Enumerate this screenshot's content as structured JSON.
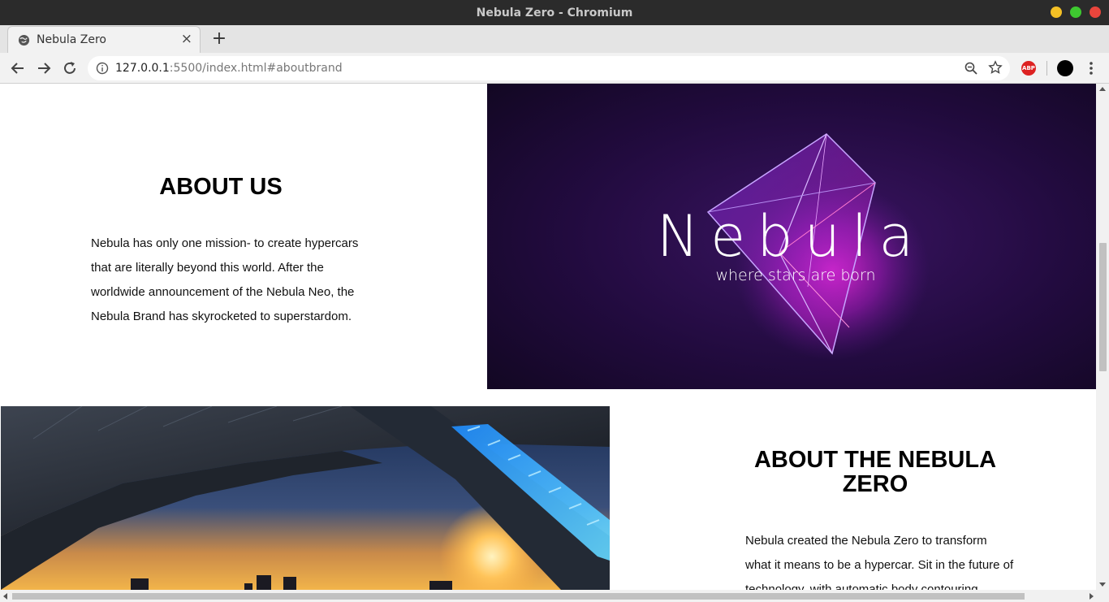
{
  "window": {
    "title": "Nebula Zero - Chromium"
  },
  "tabs": [
    {
      "title": "Nebula Zero",
      "icon": "globe-icon",
      "close": "×"
    }
  ],
  "new_tab": "+",
  "omnibox": {
    "host": "127.0.0.1",
    "rest": ":5500/index.html#aboutbrand"
  },
  "extensions": {
    "abp": "ABP"
  },
  "about": {
    "heading": "ABOUT US",
    "text": "Nebula has only one mission- to create hypercars that are literally beyond this world. After the worldwide announcement of the Nebula Neo, the Nebula Brand has skyrocketed to superstardom."
  },
  "brand_image": {
    "logo_text": "Nebula",
    "tagline": "where stars are born"
  },
  "zero": {
    "heading": "ABOUT THE NEBULA ZERO",
    "text": "Nebula created the Nebula Zero to transform what it means to be a hypercar. Sit in the future of technology, with automatic body contouring"
  },
  "colors": {
    "brand_purple": "#2a0d44",
    "accent_magenta": "#c21bd0"
  }
}
